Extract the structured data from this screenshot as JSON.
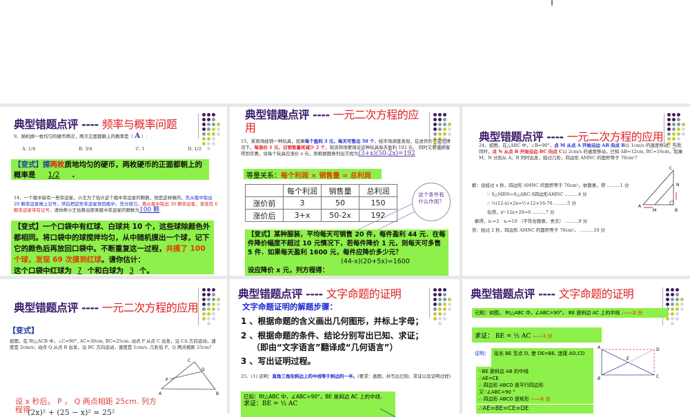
{
  "colors": {
    "title_dark": "#3a1a6a",
    "title_red": "#e02020",
    "highlight_green": "#8ef04a",
    "dot_purple": "#3d1d5c",
    "dot_teal": "#7a9e9e",
    "dot_yellow": "#c8c83c",
    "dot_light": "#d8d8e0"
  },
  "slides": [
    {
      "title_prefix": "典型错题点评 ---- ",
      "title_topic": "频率与概率问题",
      "q9": "9、随机掷一枚均匀的硬币两次，两次正面都朝上的概率是（",
      "q9_answer": "A",
      "q9_end": "）.",
      "options": [
        "A. 1/4",
        "B. 3/4",
        "C. 1",
        "D. 1/2"
      ],
      "variant1_a": "【变式】掷",
      "variant1_b": "两枚",
      "variant1_c": "质地均匀的硬币，两枚硬币的正面都朝上的概率是",
      "variant1_answer": "1/2",
      "q14_a": "14、一个瓶中装有一些幸运星，小王为了估计这个瓶中幸运星的颗数，他是这样做的，",
      "q14_b": "先从瓶中取出 20 颗幸运星做上记号，然后把这些幸运星放回瓶中，充分摇匀，",
      "q14_c": "再从瓶中取出 30 颗幸运星，发现有 6 颗幸运星带有记号，",
      "q14_d": "请你帮小王估算出原来瓶中幸运星的颗数为",
      "q14_answer": "100 颗",
      "variant2_a": "【变式】一个口袋中有红球、白球共 10 个，这些球除颜色外都相同。将口袋中的球搅拌均匀，从中随机摸出一个球，记下它的颜色后再放回口袋中。不断重复这一过程，",
      "variant2_b": "共摸了 100 个球，发现 69 次摸到红球",
      "variant2_c": "。请你估计：",
      "variant2_d": "这个口袋中红球为",
      "variant2_red": "7",
      "variant2_e": "个和白球为",
      "variant2_white": "3",
      "variant2_f": "个。"
    },
    {
      "title_prefix": "典型错趣点评 ---- ",
      "title_topic": "一元二次方程的应用",
      "q15_a": "15、某商场经销一种玩具，如果",
      "q15_b": "每个盈利 3 元，每天可售出 50 个",
      "q15_c": "，经市场调查发现，在进货价不变的情况下，",
      "q15_d": "每涨价 1 元，日销售量将减少 2 个",
      "q15_e": "，现该商场要保证这种玩具每天盈利 192 元， 同时又要使顾客得到实惠，设每个玩具应涨价 x 元，则根据题意列出方程为",
      "q15_answer": "(3+x)(50-2x)=192",
      "relation_label": "等量关系：",
      "relation": "每个利润 × 销售量 = 总利润",
      "table": {
        "headers": [
          "",
          "每个利润",
          "销售量",
          "总利润"
        ],
        "rows": [
          [
            "涨价前",
            "3",
            "50",
            "150"
          ],
          [
            "涨价后",
            "3+x",
            "50-2x",
            "192"
          ]
        ]
      },
      "callout": "这个条件有什么作用？",
      "variant": "【变式】某种服装，平均每天可销售 20 件，每件盈利 44 元．在每件降价幅度不超过 10 元情况下，若每件降价 1 元，则每天可多售 5 件．如果每天盈利 1600 元，每件应降价多少元？",
      "variant_eq": "(44-x)(20+5x)=1600",
      "variant_last": "设应降价 x 元，列方程得："
    },
    {
      "title_prefix": "典型错题点评 ---- ",
      "title_topic": "一元二次方程的应用",
      "q24_a": "24、如图，在△ABC 中，∠B=90°，",
      "q24_b": "点 M 从点 A 开始沿边 AB 向点 B",
      "q24_c": "以 1cm/s 的速度移动，与此同时，",
      "q24_d": "点 N 从点 B 开始沿边 BC 向点 C",
      "q24_e": "以 2cm/s 的速度移动，已知 AB=12cm, BC=16cm，如果 M、N 分别从 A、B 同时出发，经过几秒，四边形 AMNC 的面积等于 76cm²？",
      "solution": [
        "解：设经过 x 秒，四边形 AMNC 的面积等于 76cm²，依题意，得 ………1 分",
        "∵ S△MBN=S△ABC-S四边形AMNC ………4 分",
        "∴ ½(12-x)×2x=½×12×16-76 ………5 分",
        "化得，x²-12x+20=0 ………7 分",
        "解得，x₁=2　x₂=10 （不符合题意，舍去） ………9 分",
        "答：经过 2 秒，四边形 AMNC 的面积等于 76cm²。 ………10 分"
      ],
      "labels": [
        "C",
        "N",
        "A",
        "M",
        "B"
      ]
    },
    {
      "title_prefix": "典型错题点评 ---- ",
      "title_topic": "一元二次方程的应用",
      "variant_label": "【变式】",
      "text": "如图，在 Rt△ACB 中，∠C=90°, AC=30cm, BC=25cm. 动点 P 从点 C 出发，沿 CA 方向运动，速度是 2cm/s；动点 Q 从点 B 出发，沿 BC 方向运动，速度是 1cm/s. 几秒后 P、Q 两点相距 25cm?",
      "labels": [
        "C",
        "Q",
        "P",
        "A",
        "B"
      ],
      "answer": "设 x 秒后， P ， Q 两点相距 25cm. 列方程得",
      "equation": "(2x)² + (25 − x)² = 25²"
    },
    {
      "title_prefix": "典型错题点评 ---- ",
      "title_topic": "文字命题的证明",
      "steps_title": "文字命题证明的解题步骤：",
      "steps": [
        "1 、根据命题的含义画出几何图形，并标上字母；",
        "2 、根据命题的条件、结论分别写出已知、求证；",
        "（即由“文字语言”翻译成“几何语言”）",
        "3 、写出证明过程。"
      ],
      "q25_a": "25、(1) 证明：",
      "q25_b": "直角三角形斜边上的中线等于斜边的一半。",
      "q25_c": "(要求：画图，并写出已知、求证以及证明过程)",
      "given": "已知：Rt△ABC 中，∠ABC=90°，BE 是斜边 AC 上的中线．",
      "prove": "求证：BE = ½ AC"
    },
    {
      "title_prefix": "典型错题点评 ---- ",
      "title_topic": "文字命题的证明",
      "given": "已知：如图， Rt△ABC 中，∠ABC=90°， BE 是斜边 AC 上的中线 .",
      "given_score": "——2 分",
      "prove": "求证： BE = ½ AC",
      "prove_score": "——3 分",
      "proof_label": "证明：",
      "proof1": "延长 BE 至点 D, 使 DE=BE, 连接 AD,CD",
      "proof2": [
        "∵BE 是斜边 AB 的中线",
        "∴AE=CE",
        "∴ 四边形 ABCD 是平行四边形",
        "又∵∠ABC=90 °",
        "∴ 四边形 ABCD 是矩形"
      ],
      "proof2_score": "——6 分",
      "proof3": "∴AE=BE=CE=DE",
      "labels": [
        "A",
        "D",
        "E",
        "B",
        "C"
      ]
    }
  ]
}
